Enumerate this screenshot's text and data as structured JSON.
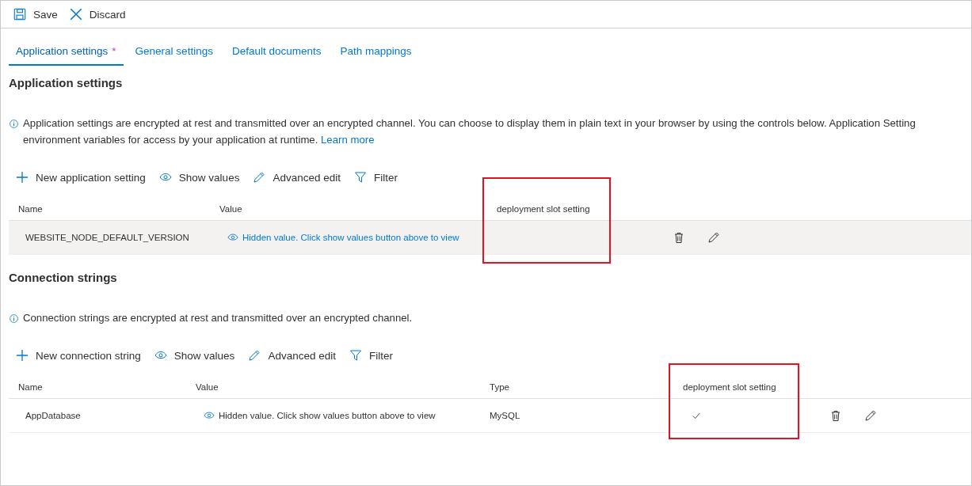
{
  "toolbar": [
    {
      "kind": "save",
      "label": "Save"
    },
    {
      "kind": "discard",
      "label": "Discard"
    }
  ],
  "tabs": [
    {
      "label": "Application settings",
      "selected": true,
      "modified": true,
      "modified_mark": "*"
    },
    {
      "label": "General settings",
      "selected": false,
      "modified": false
    },
    {
      "label": "Default documents",
      "selected": false,
      "modified": false
    },
    {
      "label": "Path mappings",
      "selected": false,
      "modified": false
    }
  ],
  "sections": [
    {
      "title": "Application settings",
      "info_line1": "Application settings are encrypted at rest and transmitted over an encrypted channel. You can choose to display them in plain text in your browser by using the controls below. Application Setting",
      "info_line2": "environment variables for access by your application at runtime.",
      "learn_more": "Learn more",
      "commands": [
        {
          "kind": "add",
          "label": "New application setting"
        },
        {
          "kind": "show",
          "label": "Show values"
        },
        {
          "kind": "edit",
          "label": "Advanced edit"
        },
        {
          "kind": "filter",
          "label": "Filter"
        }
      ],
      "columns": [
        {
          "kind": "name",
          "label": "Name"
        },
        {
          "kind": "value",
          "label": "Value"
        },
        {
          "kind": "slot",
          "label": "deployment slot setting",
          "highlighted": true
        },
        {
          "kind": "actions"
        }
      ],
      "rows": [
        {
          "name": "WEBSITE_NODE_DEFAULT_VERSION",
          "value": "Hidden value. Click show values button above to view",
          "value_link": true,
          "slot_setting": false,
          "shaded": true
        }
      ]
    },
    {
      "title": "Connection strings",
      "info_line1": "Connection strings are encrypted at rest and transmitted over an encrypted channel.",
      "commands": [
        {
          "kind": "add",
          "label": "New connection string"
        },
        {
          "kind": "show",
          "label": "Show values"
        },
        {
          "kind": "edit",
          "label": "Advanced edit"
        },
        {
          "kind": "filter",
          "label": "Filter"
        }
      ],
      "columns": [
        {
          "kind": "name",
          "label": "Name"
        },
        {
          "kind": "value",
          "label": "Value"
        },
        {
          "kind": "type",
          "label": "Type"
        },
        {
          "kind": "slot",
          "label": "deployment slot setting",
          "highlighted": true
        },
        {
          "kind": "actions"
        }
      ],
      "rows": [
        {
          "name": "AppDatabase",
          "value": "Hidden value. Click show values button above to view",
          "value_link": false,
          "type": "MySQL",
          "slot_setting": true,
          "shaded": false
        }
      ]
    }
  ]
}
